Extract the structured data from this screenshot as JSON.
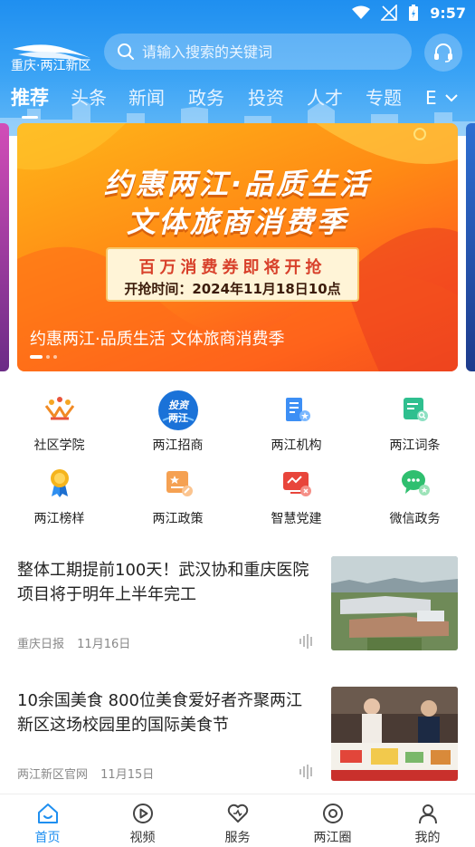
{
  "status": {
    "time": "9:57"
  },
  "header": {
    "logo_text": "重庆·两江新区",
    "search_placeholder": "请输入搜索的关键词",
    "tabs": [
      "推荐",
      "头条",
      "新闻",
      "政务",
      "投资",
      "人才",
      "专题",
      "E"
    ]
  },
  "banner": {
    "title_line1": "约惠两江·品质生活",
    "title_line2": "文体旅商消费季",
    "coupon_line1": "百万消费券即将开抢",
    "coupon_line2": "开抢时间：2024年11月18日10点",
    "caption": "约惠两江·品质生活 文体旅商消费季"
  },
  "grid": [
    {
      "label": "社区学院",
      "icon": "community-college-icon"
    },
    {
      "label": "两江招商",
      "icon": "investment-icon",
      "badge_line1": "投资",
      "badge_line2": "两江"
    },
    {
      "label": "两江机构",
      "icon": "institution-icon"
    },
    {
      "label": "两江词条",
      "icon": "glossary-icon"
    },
    {
      "label": "两江榜样",
      "icon": "medal-icon"
    },
    {
      "label": "两江政策",
      "icon": "policy-icon"
    },
    {
      "label": "智慧党建",
      "icon": "party-building-icon"
    },
    {
      "label": "微信政务",
      "icon": "wechat-icon"
    }
  ],
  "news": [
    {
      "title": "整体工期提前100天！武汉协和重庆医院项目将于明年上半年完工",
      "source": "重庆日报",
      "date": "11月16日"
    },
    {
      "title": "10余国美食 800位美食爱好者齐聚两江新区这场校园里的国际美食节",
      "source": "两江新区官网",
      "date": "11月15日"
    }
  ],
  "nav": [
    {
      "label": "首页",
      "icon": "home-icon"
    },
    {
      "label": "视频",
      "icon": "video-icon"
    },
    {
      "label": "服务",
      "icon": "service-heart-icon"
    },
    {
      "label": "两江圈",
      "icon": "circle-icon"
    },
    {
      "label": "我的",
      "icon": "profile-icon"
    }
  ],
  "colors": {
    "brand": "#1f8ff0",
    "banner_orange": "#ff8a14"
  }
}
